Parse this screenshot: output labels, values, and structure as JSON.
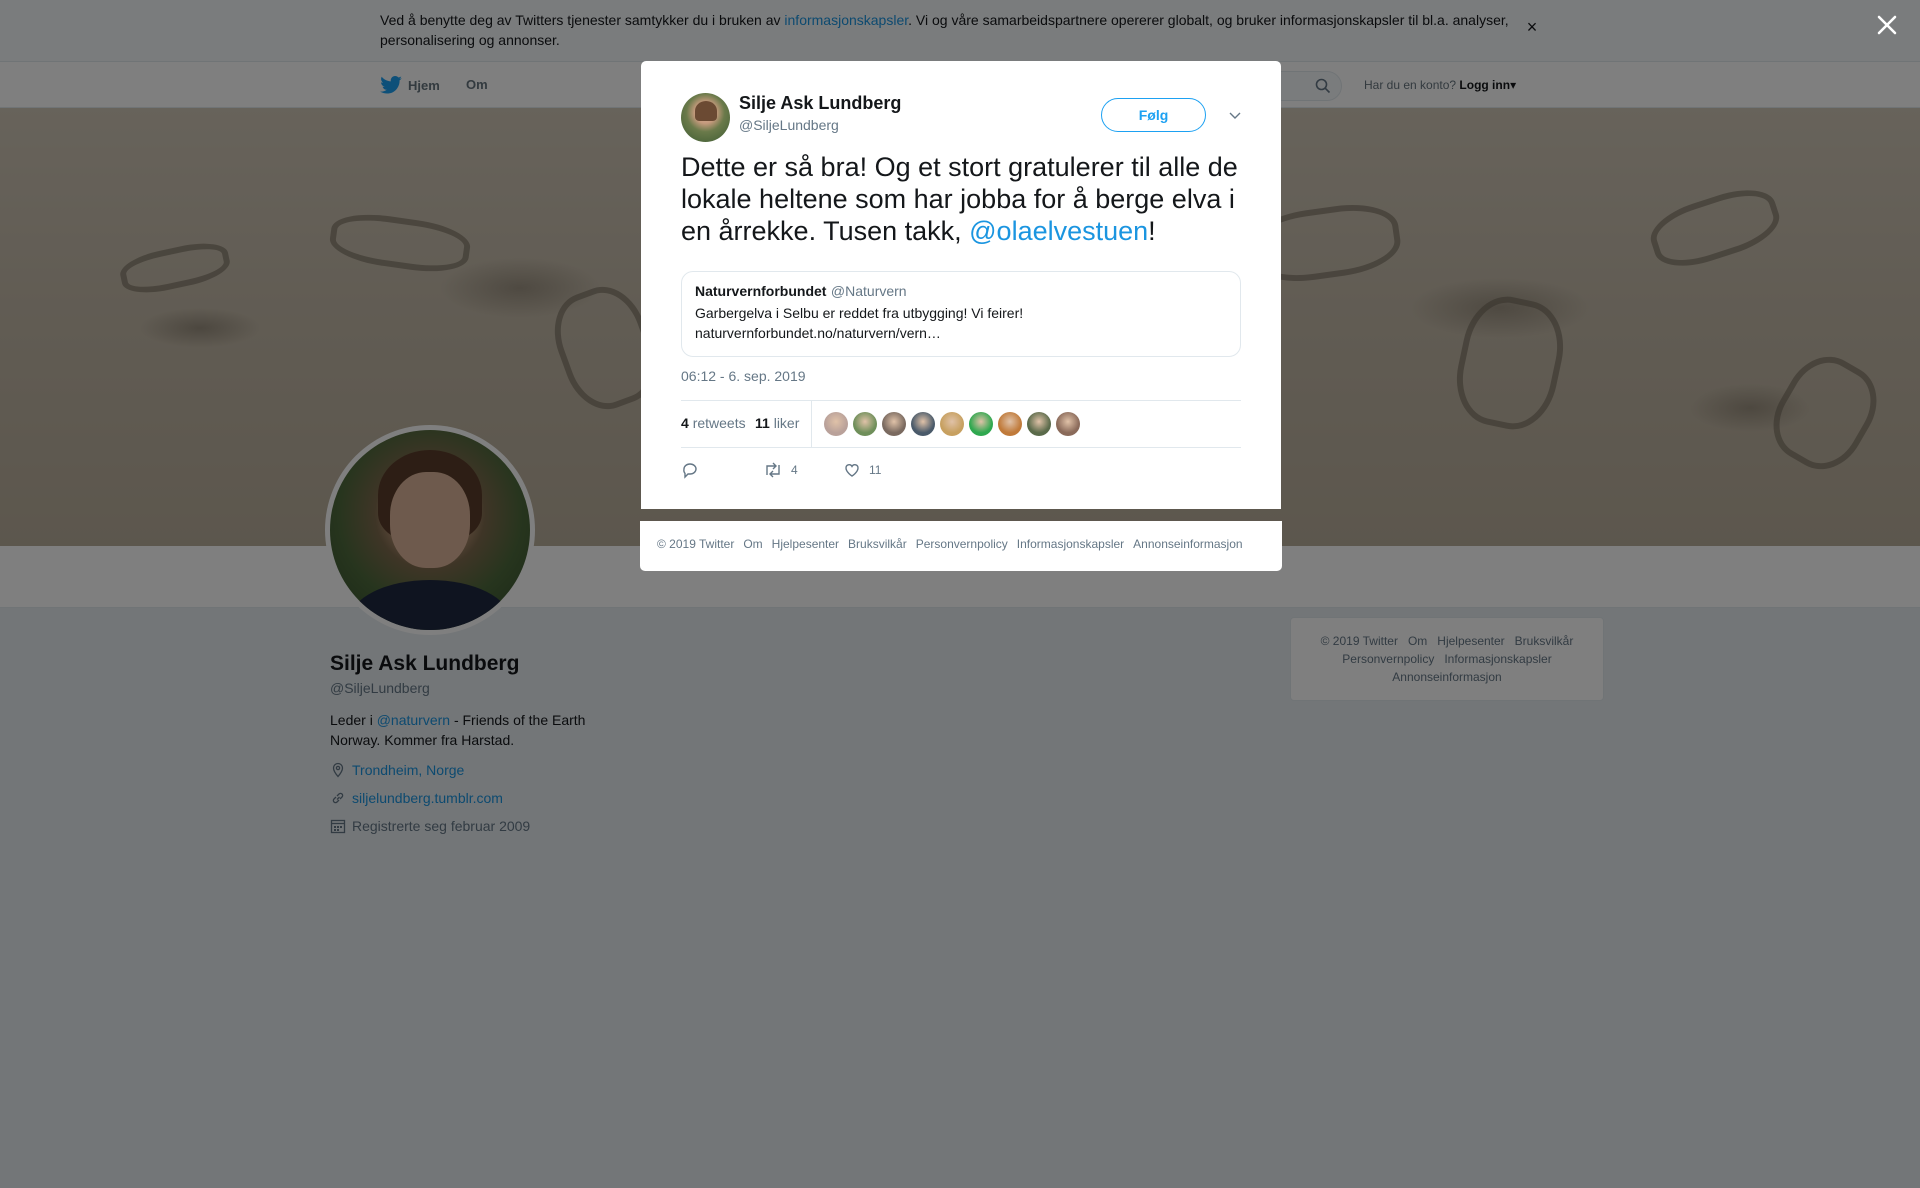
{
  "cookie": {
    "text_before": "Ved å benytte deg av Twitters tjenester samtykker du i bruken av ",
    "link": "informasjonskapsler",
    "text_after": ". Vi og våre samarbeidspartnere opererer globalt, og bruker informasjonskapsler til bl.a. analyser, personalisering og annonser.",
    "close": "×"
  },
  "nav": {
    "home": "Hjem",
    "about": "Om",
    "search_placeholder": "",
    "login_question": "Har du en konto?",
    "login": "Logg inn"
  },
  "profile": {
    "name": "Silje Ask Lundberg",
    "handle": "@SiljeLundberg",
    "bio_before": "Leder i ",
    "bio_mention": "@naturvern",
    "bio_after": " - Friends of the Earth Norway. Kommer fra Harstad.",
    "location": "Trondheim, Norge",
    "url": "siljelundberg.tumblr.com",
    "joined": "Registrerte seg februar 2009"
  },
  "side_footer": {
    "items": [
      "© 2019 Twitter",
      "Om",
      "Hjelpesenter",
      "Bruksvilkår",
      "Personvernpolicy",
      "Informasjonskapsler",
      "Annonseinformasjon"
    ]
  },
  "tweet": {
    "name": "Silje Ask Lundberg",
    "handle": "@SiljeLundberg",
    "follow": "Følg",
    "text_before": "Dette er så bra! Og et stort gratulerer til alle de lokale heltene som har jobba for å berge elva i en årrekke. Tusen takk, ",
    "mention": "@olaelvestuen",
    "text_after": "!",
    "quote": {
      "name": "Naturvernforbundet",
      "handle": "@Naturvern",
      "text": "Garbergelva i Selbu er reddet fra utbygging! Vi feirer! naturvernforbundet.no/naturvern/vern…"
    },
    "time": "06:12 - 6. sep. 2019",
    "retweets_count": "4",
    "retweets_label": "retweets",
    "likes_count": "11",
    "likes_label": "liker",
    "liker_colors": [
      "#b9a19a",
      "#6f8f5a",
      "#7a6a60",
      "#4a5a6a",
      "#c7a060",
      "#2fa84f",
      "#c07a3a",
      "#5a6a4a",
      "#8a6a5a"
    ],
    "action_retweets": "4",
    "action_likes": "11"
  },
  "modal_footer": {
    "items": [
      "© 2019 Twitter",
      "Om",
      "Hjelpesenter",
      "Bruksvilkår",
      "Personvernpolicy",
      "Informasjonskapsler",
      "Annonseinformasjon"
    ]
  }
}
